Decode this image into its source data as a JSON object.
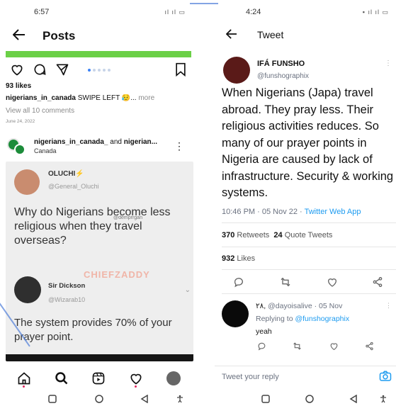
{
  "left": {
    "status_time": "6:57",
    "status_icons": "ıl ıl ▭",
    "title": "Posts",
    "likes": "93 likes",
    "caption_user": "nigerians_in_canada",
    "caption_text": "SWIPE LEFT 😥...",
    "caption_more": "more",
    "view_all": "View all 10 comments",
    "date": "June 24, 2022",
    "post2_user1": "nigerians_in_canada_",
    "post2_and": "and",
    "post2_user2": "nigerian...",
    "post2_location": "Canada",
    "quote_name": "OLUCHI",
    "quote_bolt": "⚡",
    "quote_handle": "@General_Oluchi",
    "quote_text": "Why do Nigerians become less religious when they travel overseas?",
    "quote_watermark": "@demprrgan",
    "quote_watermark2": "CHIEFZADDY",
    "reply_name": "Sir Dickson",
    "reply_handle": "@Wizarab10",
    "reply_text": "The system provides 70% of your prayer point.",
    "carousel_index": 1,
    "carousel_count": 5
  },
  "right": {
    "status_time": "4:24",
    "status_icons": "▪ ıl ıl ▭",
    "title": "Tweet",
    "author_name": "IFÁ FUNSHO",
    "author_handle": "@funshographix",
    "body": "When Nigerians (Japa) travel abroad. They pray less. Their religious activities reduces. So many of our prayer points in Nigeria are caused by lack of infrastructure. Security & working systems.",
    "meta_time": "10:46 PM · 05 Nov 22 ·",
    "meta_source": "Twitter Web App",
    "retweets_count": "370",
    "retweets_label": "Retweets",
    "quotes_count": "24",
    "quotes_label": "Quote Tweets",
    "likes_count": "932",
    "likes_label": "Likes",
    "reply_name": "٢٨,",
    "reply_handle_date": "@dayoisalive · 05 Nov",
    "replying_to_label": "Replying to",
    "replying_to_handle": "@funshographix",
    "reply_text": "yeah",
    "reply_placeholder": "Tweet your reply"
  },
  "colors": {
    "green_bar": "#6bd047",
    "twitter_blue": "#1d9bf0",
    "ig_carousel_active": "#3b82f6"
  }
}
